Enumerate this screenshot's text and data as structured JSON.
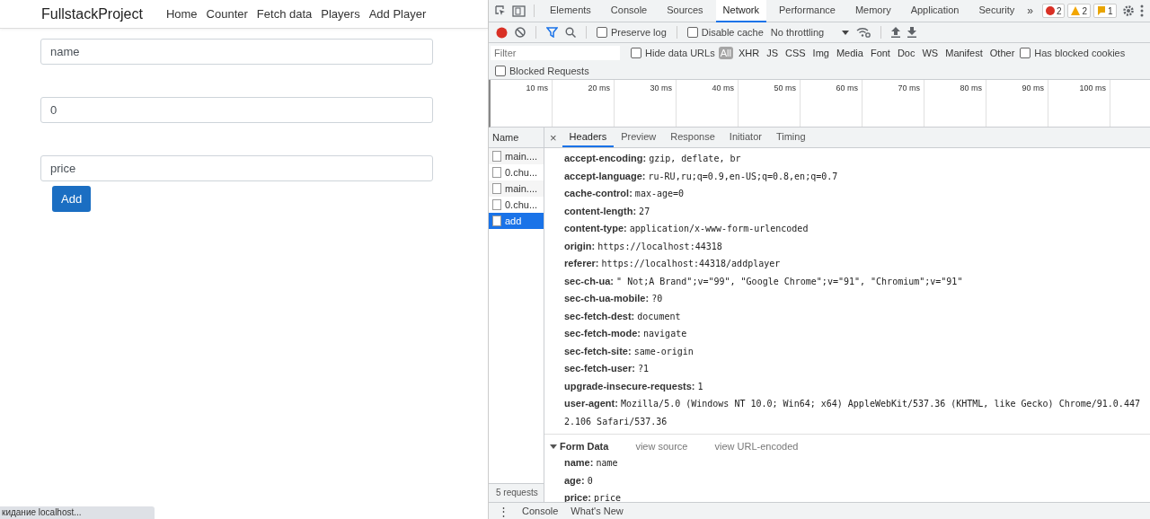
{
  "app": {
    "brand": "FullstackProject",
    "nav": [
      "Home",
      "Counter",
      "Fetch data",
      "Players",
      "Add Player"
    ],
    "fields": [
      {
        "value": "name"
      },
      {
        "value": "0"
      },
      {
        "value": "price"
      }
    ],
    "submit_button": "Add"
  },
  "browser_status": "кидание localhost...",
  "devtools": {
    "tabs": [
      {
        "label": "Elements",
        "selected": false
      },
      {
        "label": "Console",
        "selected": false
      },
      {
        "label": "Sources",
        "selected": false
      },
      {
        "label": "Network",
        "selected": true
      },
      {
        "label": "Performance",
        "selected": false
      },
      {
        "label": "Memory",
        "selected": false
      },
      {
        "label": "Application",
        "selected": false
      },
      {
        "label": "Security",
        "selected": false
      }
    ],
    "more_tabs": "»",
    "counters": [
      {
        "kind": "error",
        "count": "2"
      },
      {
        "kind": "warning",
        "count": "2"
      },
      {
        "kind": "issue",
        "count": "1"
      }
    ],
    "toolbar": {
      "recording": true,
      "filter_active": true,
      "preserve_log": {
        "label": "Preserve log",
        "checked": false
      },
      "disable_cache": {
        "label": "Disable cache",
        "checked": false
      },
      "throttling": "No throttling"
    },
    "filter": {
      "placeholder": "Filter",
      "hide_data_urls": {
        "label": "Hide data URLs",
        "checked": false
      },
      "types": [
        {
          "label": "All",
          "selected": true
        },
        {
          "label": "XHR",
          "selected": false
        },
        {
          "label": "JS",
          "selected": false
        },
        {
          "label": "CSS",
          "selected": false
        },
        {
          "label": "Img",
          "selected": false
        },
        {
          "label": "Media",
          "selected": false
        },
        {
          "label": "Font",
          "selected": false
        },
        {
          "label": "Doc",
          "selected": false
        },
        {
          "label": "WS",
          "selected": false
        },
        {
          "label": "Manifest",
          "selected": false
        },
        {
          "label": "Other",
          "selected": false
        }
      ],
      "has_blocked_cookies": {
        "label": "Has blocked cookies",
        "checked": false
      },
      "blocked_requests": {
        "label": "Blocked Requests",
        "checked": false
      }
    },
    "timeline_ticks": [
      "10 ms",
      "20 ms",
      "30 ms",
      "40 ms",
      "50 ms",
      "60 ms",
      "70 ms",
      "80 ms",
      "90 ms",
      "100 ms"
    ],
    "requests": {
      "heading": "Name",
      "items": [
        {
          "name": "main....",
          "selected": false
        },
        {
          "name": "0.chu...",
          "selected": false
        },
        {
          "name": "main....",
          "selected": false
        },
        {
          "name": "0.chu...",
          "selected": false
        },
        {
          "name": "add",
          "selected": true
        }
      ],
      "summary": "5 requests"
    },
    "detail_close": "×",
    "detail_tabs": [
      {
        "label": "Headers",
        "selected": true
      },
      {
        "label": "Preview",
        "selected": false
      },
      {
        "label": "Response",
        "selected": false
      },
      {
        "label": "Initiator",
        "selected": false
      },
      {
        "label": "Timing",
        "selected": false
      }
    ],
    "headers": [
      {
        "name": "accept-encoding:",
        "value": "gzip, deflate, br"
      },
      {
        "name": "accept-language:",
        "value": "ru-RU,ru;q=0.9,en-US;q=0.8,en;q=0.7"
      },
      {
        "name": "cache-control:",
        "value": "max-age=0"
      },
      {
        "name": "content-length:",
        "value": "27"
      },
      {
        "name": "content-type:",
        "value": "application/x-www-form-urlencoded"
      },
      {
        "name": "origin:",
        "value": "https://localhost:44318"
      },
      {
        "name": "referer:",
        "value": "https://localhost:44318/addplayer"
      },
      {
        "name": "sec-ch-ua:",
        "value": "\" Not;A Brand\";v=\"99\", \"Google Chrome\";v=\"91\", \"Chromium\";v=\"91\""
      },
      {
        "name": "sec-ch-ua-mobile:",
        "value": "?0"
      },
      {
        "name": "sec-fetch-dest:",
        "value": "document"
      },
      {
        "name": "sec-fetch-mode:",
        "value": "navigate"
      },
      {
        "name": "sec-fetch-site:",
        "value": "same-origin"
      },
      {
        "name": "sec-fetch-user:",
        "value": "?1"
      },
      {
        "name": "upgrade-insecure-requests:",
        "value": "1"
      },
      {
        "name": "user-agent:",
        "value": "Mozilla/5.0 (Windows NT 10.0; Win64; x64) AppleWebKit/537.36 (KHTML, like Gecko) Chrome/91.0.4472.106 Safari/537.36"
      }
    ],
    "form_data": {
      "title": "Form Data",
      "expanded": true,
      "view_source": "view source",
      "view_encoded": "view URL-encoded",
      "fields": [
        {
          "name": "name:",
          "value": "name"
        },
        {
          "name": "age:",
          "value": "0"
        },
        {
          "name": "price:",
          "value": "price"
        }
      ]
    },
    "drawer": {
      "menu": "⋮",
      "tabs": [
        "Console",
        "What's New"
      ]
    }
  }
}
